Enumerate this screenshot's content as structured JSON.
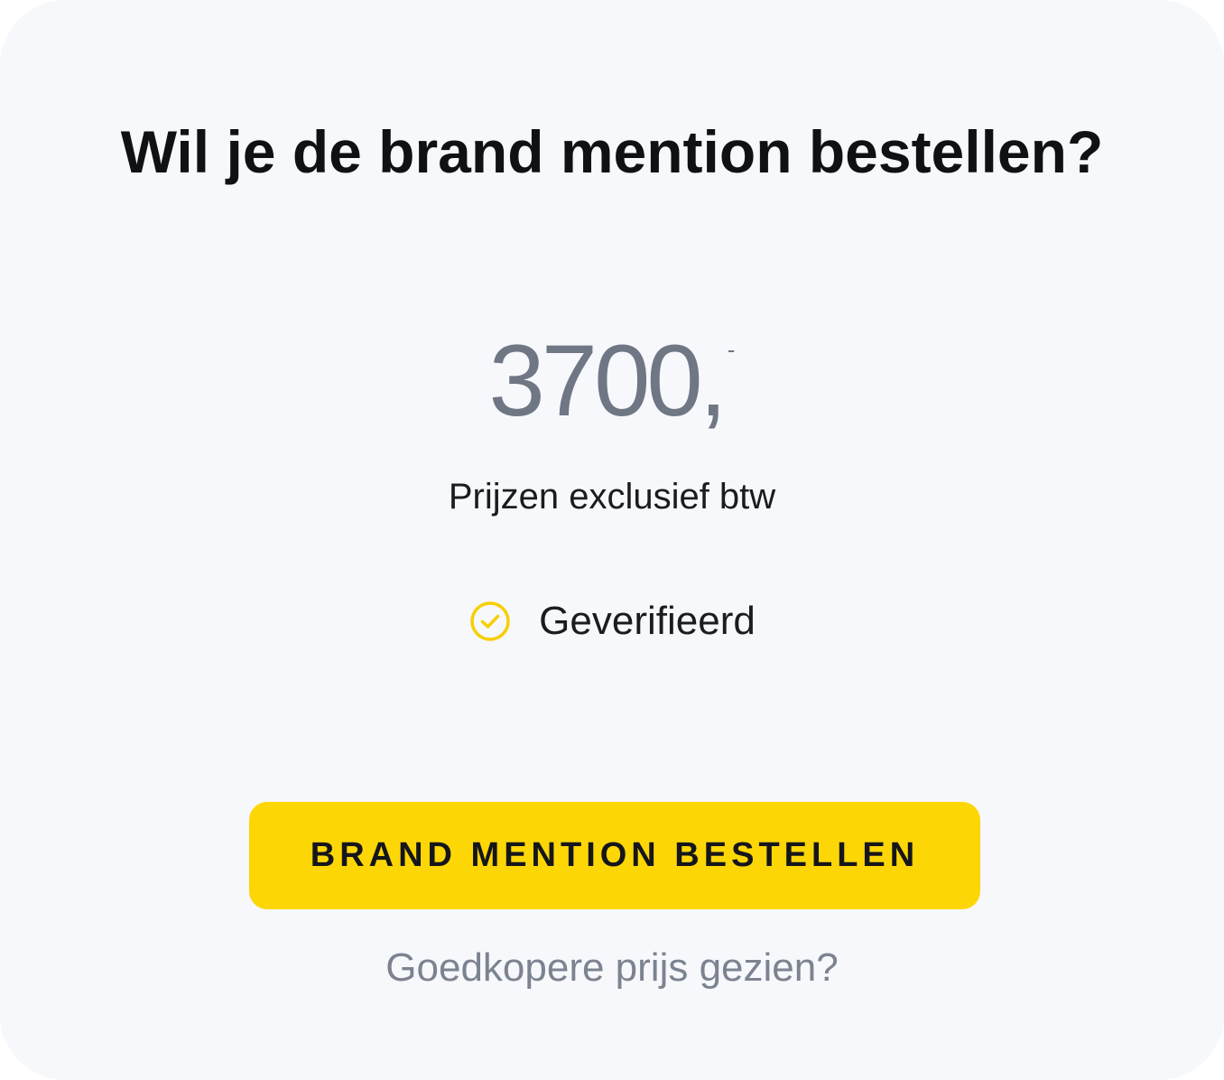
{
  "card": {
    "title": "Wil je de brand mention bestellen?",
    "price": {
      "amount": "3700,",
      "suffix": "-"
    },
    "vat_note": "Prijzen exclusief btw",
    "verified": {
      "icon": "check-circle-icon",
      "label": "Geverifieerd"
    },
    "order_button_label": "BRAND MENTION BESTELLEN",
    "cheaper_price_link": "Goedkopere prijs gezien?"
  },
  "colors": {
    "background": "#f7f8fb",
    "accent": "#fdd606",
    "title_text": "#101114",
    "price_text": "#6f7784",
    "muted_text": "#7c8390"
  }
}
